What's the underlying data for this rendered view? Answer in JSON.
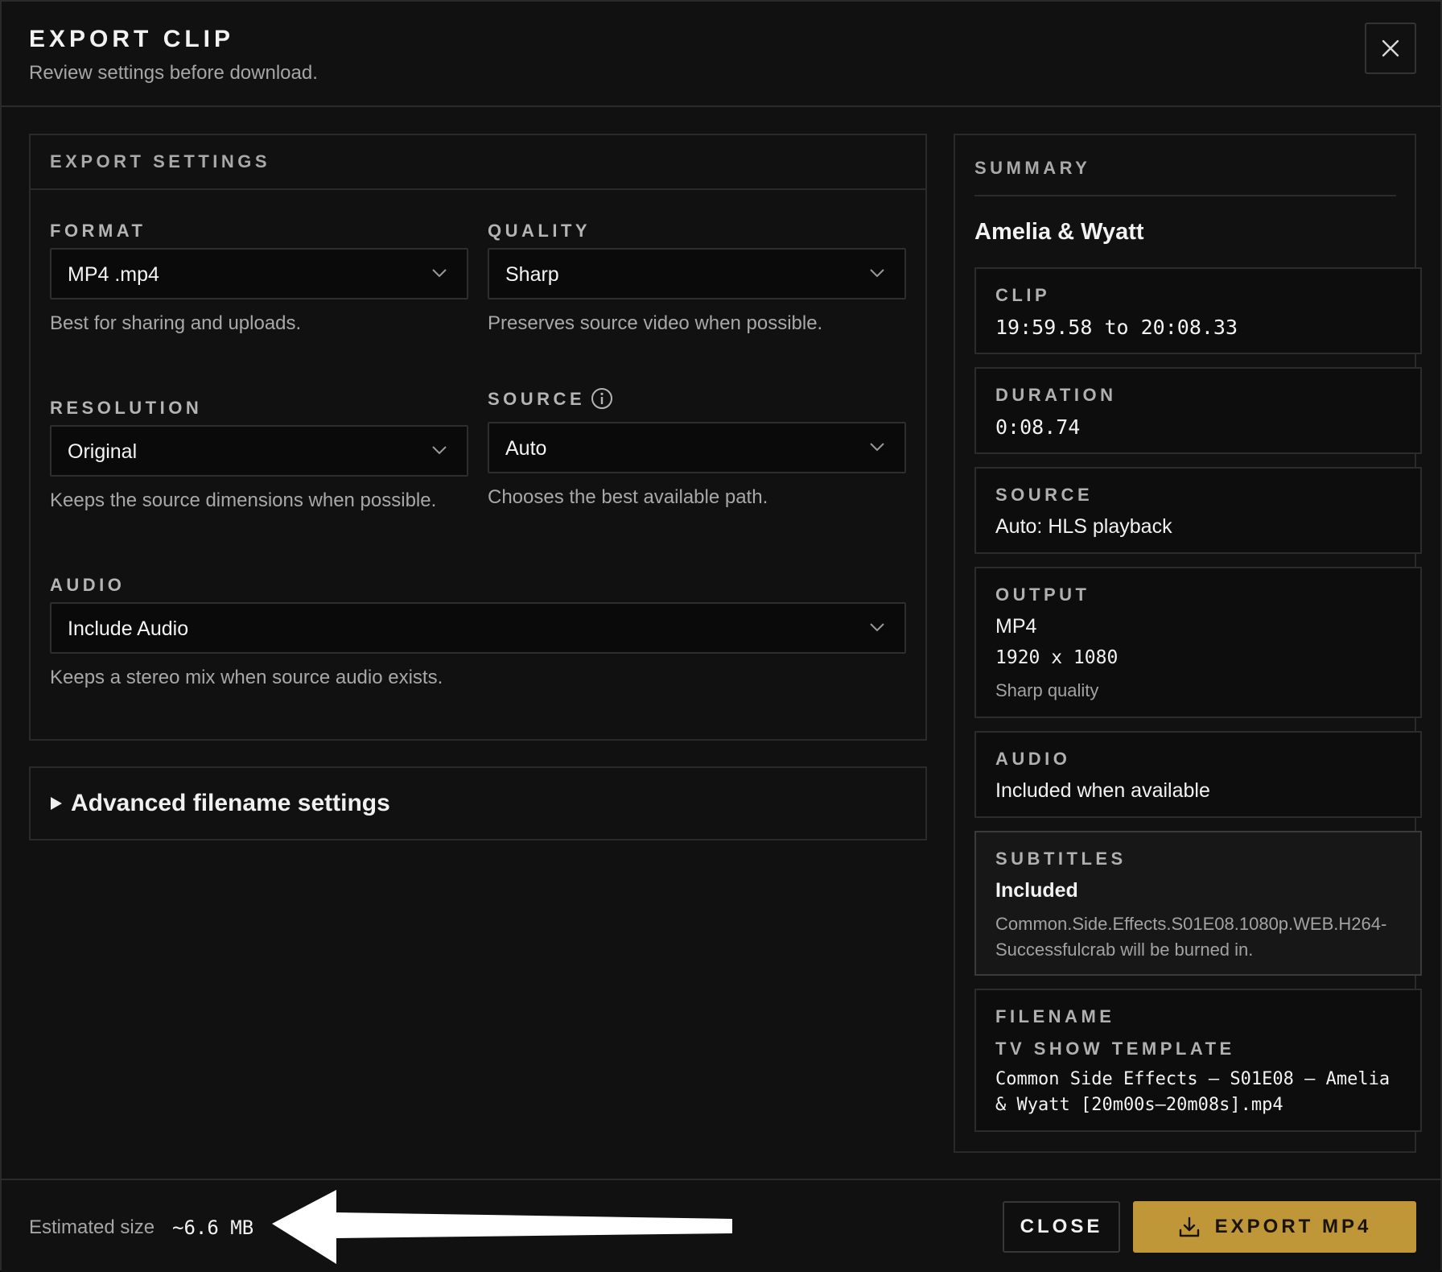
{
  "dialog": {
    "title": "EXPORT CLIP",
    "subtitle": "Review settings before download.",
    "close_icon": "close-icon"
  },
  "settings": {
    "heading": "EXPORT SETTINGS",
    "format": {
      "label": "FORMAT",
      "value": "MP4 .mp4",
      "help": "Best for sharing and uploads."
    },
    "quality": {
      "label": "QUALITY",
      "value": "Sharp",
      "help": "Preserves source video when possible."
    },
    "resolution": {
      "label": "RESOLUTION",
      "value": "Original",
      "help": "Keeps the source dimensions when possible."
    },
    "source": {
      "label": "SOURCE",
      "value": "Auto",
      "help": "Chooses the best available path.",
      "icon": "info-icon"
    },
    "audio": {
      "label": "AUDIO",
      "value": "Include Audio",
      "help": "Keeps a stereo mix when source audio exists."
    }
  },
  "advanced": {
    "label": "Advanced filename settings",
    "icon": "triangle-right-icon"
  },
  "summary": {
    "heading": "SUMMARY",
    "name": "Amelia & Wyatt",
    "clip": {
      "label": "CLIP",
      "value": "19:59.58 to 20:08.33"
    },
    "duration": {
      "label": "DURATION",
      "value": "0:08.74"
    },
    "source": {
      "label": "SOURCE",
      "value": "Auto: HLS playback"
    },
    "output": {
      "label": "OUTPUT",
      "format": "MP4",
      "dimensions": "1920 x 1080",
      "quality": "Sharp quality"
    },
    "audio": {
      "label": "AUDIO",
      "value": "Included when available"
    },
    "subtitles": {
      "label": "SUBTITLES",
      "value": "Included",
      "detail_line1": "Common.Side.Effects.S01E08.1080p.WEB.H264-",
      "detail_line2": "Successfulcrab will be burned in."
    },
    "filename": {
      "label": "FILENAME",
      "template": "TV SHOW TEMPLATE",
      "line1": "Common Side Effects – S01E08 – Amelia",
      "line2": "& Wyatt [20m00s–20m08s].mp4"
    }
  },
  "footer": {
    "estimated_label": "Estimated size",
    "estimated_value": "~6.6 MB",
    "close_label": "CLOSE",
    "export_label": "EXPORT MP4",
    "export_icon": "download-icon",
    "accent": "#bf9638"
  }
}
